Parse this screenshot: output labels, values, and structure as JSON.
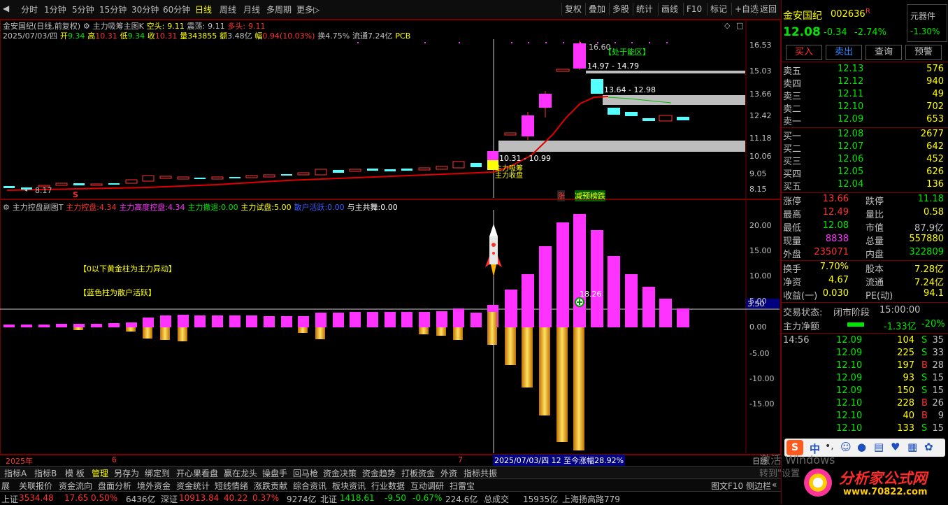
{
  "periods": [
    "分时",
    "1分钟",
    "5分钟",
    "15分钟",
    "30分钟",
    "60分钟",
    "日线",
    "周线",
    "月线",
    "多周期",
    "更多▷"
  ],
  "active_period": "日线",
  "right_tools": [
    "复权",
    "叠加",
    "多股",
    "统计",
    "画线",
    "F10",
    "标记",
    "+自选",
    "返回"
  ],
  "chart_header": {
    "name": "金安国纪(日线,前复权)",
    "indicator": "主力吸筹主图K",
    "kong_label": "空头:",
    "kong_value": "9.11",
    "zhen_label": "震荡:",
    "zhen_value": "9.11",
    "duo_label": "多头:",
    "duo_value": "9.11"
  },
  "ohlc": {
    "date": "2025/07/03/四",
    "open_label": "开",
    "open": "9.34",
    "high_label": "高",
    "high": "10.31",
    "low_label": "低",
    "low": "9.34",
    "close_label": "收",
    "close": "10.31",
    "vol_label": "量",
    "vol": "343855",
    "amt_label": "额",
    "amt": "3.48亿",
    "chg_label": "幅",
    "chg": "0.94(10.03%)",
    "turn_label": "换",
    "turn": "4.75%",
    "float_label": "流通",
    "float": "7.24亿",
    "tag": "PCB"
  },
  "main_annotations": {
    "high_label": "16.60",
    "zone_label": "【处于能区】",
    "range1": "14.97 - 14.79",
    "range2": "13.64 - 12.98",
    "range3": "10.31 - 10.99",
    "zhang_label": "涨",
    "reduce_label": "减预榜跌",
    "s_label": "S",
    "low_label": "8.17",
    "xichou_label": "主力吸筹",
    "kongpan_label": "主力收盘"
  },
  "price_axis": [
    "16.53",
    "15.03",
    "13.66",
    "12.42",
    "11.18",
    "10.06",
    "9.05",
    "8.15"
  ],
  "sub_header": {
    "name": "主力控盘副图T",
    "k1": "主力控盘:",
    "v1": "4.34",
    "k2": "主力高度控盘:",
    "v2": "4.34",
    "k3": "主力撤退:",
    "v3": "0.00",
    "k4": "主力试盘:",
    "v4": "5.00",
    "k5": "散户活跃:",
    "v5": "0.00",
    "k6": "与主共舞:",
    "v6": "0.00"
  },
  "sub_notes": {
    "note1": "【0以下黄金柱为主力异动】",
    "note2": "【蓝色柱为散户活跃】",
    "tip_value": "18.26"
  },
  "sub_axis": [
    "20.00",
    "15.00",
    "10.00",
    "5.00",
    "0.00",
    "-5.00",
    "-10.00",
    "-15.00"
  ],
  "hline_label": "3.50",
  "xaxis": {
    "year": "2025年",
    "m6": "6",
    "m7": "7",
    "period": "日线",
    "range_note": "2025/07/03/四 12 至今涨幅28.92%"
  },
  "indicator_tabs": [
    "指标A",
    "指标B",
    "模 板",
    "管理",
    "另存为",
    "绑定到",
    "开心果看盘",
    "赢在龙头",
    "操盘手",
    "回马枪",
    "资金决策",
    "资金趋势",
    "打板资金",
    "外资",
    "指标共振"
  ],
  "bottom_tabs": [
    "展",
    "关联报价",
    "资金流向",
    "盘面分析",
    "境外资金",
    "资金统计",
    "短线情绪",
    "涨跌贡献",
    "综合资讯",
    "板块资讯",
    "行业数据",
    "互动调研",
    "扫雷宝"
  ],
  "bottom_right": [
    "图文F10",
    "侧边栏"
  ],
  "ticker": {
    "sh_label": "上证",
    "sh_val": "3534.48",
    "sh_chg": "17.65",
    "sh_pct": "0.50%",
    "sh_amt": "6436亿",
    "sz_label": "深证",
    "sz_val": "10913.84",
    "sz_chg": "40.22",
    "sz_pct": "0.37%",
    "sz_amt": "9274亿",
    "bz_label": "北证",
    "bz_val": "1418.61",
    "bz_chg": "-9.50",
    "bz_pct": "-0.67%",
    "bz_amt": "224.6亿",
    "total_label": "总成交",
    "total_amt": "15935亿",
    "extra": "上海扬高路779"
  },
  "stock": {
    "name": "金安国纪",
    "code": "002636",
    "badge": "R",
    "price": "12.08",
    "chg": "-0.34",
    "pct": "-2.74%",
    "sector_name": "元器件",
    "sector_pct": "-1.30%"
  },
  "trade_buttons": [
    "买入",
    "卖出",
    "查询",
    "预警"
  ],
  "sell_orders": [
    {
      "label": "卖五",
      "price": "12.13",
      "vol": "576"
    },
    {
      "label": "卖四",
      "price": "12.12",
      "vol": "940"
    },
    {
      "label": "卖三",
      "price": "12.11",
      "vol": "49"
    },
    {
      "label": "卖二",
      "price": "12.10",
      "vol": "702"
    },
    {
      "label": "卖一",
      "price": "12.09",
      "vol": "653"
    }
  ],
  "buy_orders": [
    {
      "label": "买一",
      "price": "12.08",
      "vol": "2677"
    },
    {
      "label": "买二",
      "price": "12.07",
      "vol": "642"
    },
    {
      "label": "买三",
      "price": "12.06",
      "vol": "452"
    },
    {
      "label": "买四",
      "price": "12.05",
      "vol": "626"
    },
    {
      "label": "买五",
      "price": "12.04",
      "vol": "136"
    }
  ],
  "stats": [
    {
      "k1": "涨停",
      "v1": "13.66",
      "k2": "跌停",
      "v2": "11.18"
    },
    {
      "k1": "最高",
      "v1": "12.49",
      "k2": "量比",
      "v2": "0.58"
    },
    {
      "k1": "最低",
      "v1": "12.08",
      "k2": "市值",
      "v2": "87.9亿"
    },
    {
      "k1": "现量",
      "v1": "8838",
      "k2": "总量",
      "v2": "557880"
    },
    {
      "k1": "外盘",
      "v1": "235071",
      "k2": "内盘",
      "v2": "322809"
    },
    {
      "k1": "换手",
      "v1": "7.70%",
      "k2": "股本",
      "v2": "7.28亿"
    },
    {
      "k1": "净资",
      "v1": "4.67",
      "k2": "流通",
      "v2": "7.24亿"
    },
    {
      "k1": "收益(一)",
      "v1": "0.030",
      "k2": "PE(动)",
      "v2": "94.1"
    }
  ],
  "trade_status": {
    "label": "交易状态:",
    "value": "闭市阶段",
    "time": "15:00:00"
  },
  "net_flow": {
    "label": "主力净额",
    "value": "-1.33亿",
    "pct": "-20%"
  },
  "ticks": [
    {
      "time": "14:56",
      "price": "12.09",
      "vol": "104",
      "side": "S",
      "n": "35"
    },
    {
      "time": "",
      "price": "12.09",
      "vol": "225",
      "side": "S",
      "n": "33"
    },
    {
      "time": "",
      "price": "12.10",
      "vol": "197",
      "side": "B",
      "n": "28"
    },
    {
      "time": "",
      "price": "12.09",
      "vol": "93",
      "side": "S",
      "n": "15"
    },
    {
      "time": "",
      "price": "12.09",
      "vol": "150",
      "side": "S",
      "n": "15"
    },
    {
      "time": "",
      "price": "12.10",
      "vol": "228",
      "side": "B",
      "n": "26"
    },
    {
      "time": "",
      "price": "12.10",
      "vol": "40",
      "side": "B",
      "n": "9"
    },
    {
      "time": "",
      "price": "12.10",
      "vol": "133",
      "side": "S",
      "n": "15"
    }
  ],
  "ime": {
    "lang": "中"
  },
  "watermark": "激活 Windows",
  "watermark2": "转到\"设置\"以激活",
  "brand": {
    "name": "分析家公式网",
    "url": "www.70822.com"
  },
  "colors": {
    "up": "#ff3232",
    "down": "#00e600",
    "magenta": "#ff33ff",
    "cyan": "#54ffff",
    "gold": "#ffb000",
    "yellow": "#ffff00",
    "maroon": "#7a0000"
  }
}
